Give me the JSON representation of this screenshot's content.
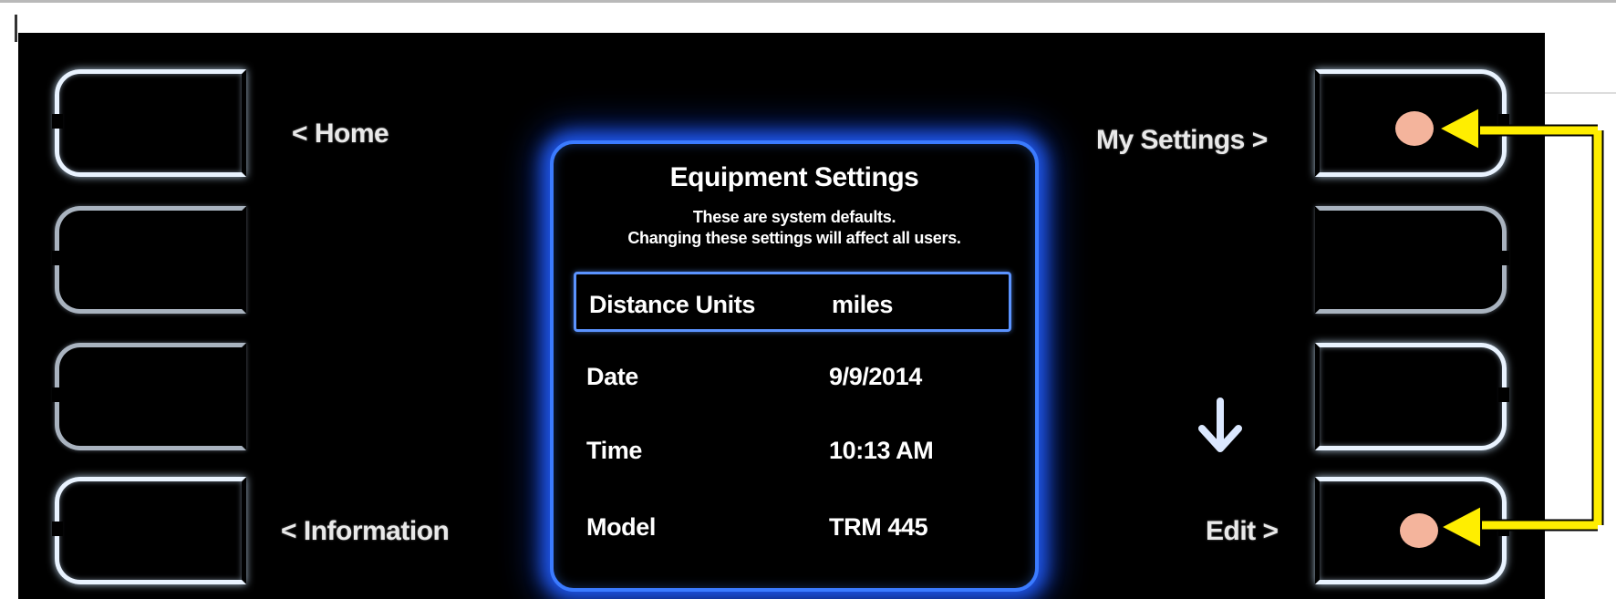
{
  "nav": {
    "home": "< Home",
    "my_settings": "My Settings >",
    "information": "< Information",
    "edit": "Edit >"
  },
  "panel": {
    "title": "Equipment Settings",
    "subtitle_line1": "These are system defaults.",
    "subtitle_line2": "Changing these settings will affect all users.",
    "rows": [
      {
        "label": "Distance Units",
        "value": "miles",
        "selected": true
      },
      {
        "label": "Date",
        "value": "9/9/2014",
        "selected": false
      },
      {
        "label": "Time",
        "value": "10:13 AM",
        "selected": false
      },
      {
        "label": "Model",
        "value": "TRM 445",
        "selected": false
      }
    ]
  },
  "icons": {
    "scroll": "arrow-down-icon"
  },
  "colors": {
    "screen_background": "#000000",
    "panel_glow": "#2f6bff",
    "annotation_arrow": "#ffee00",
    "annotation_dot": "#f4b49c"
  }
}
